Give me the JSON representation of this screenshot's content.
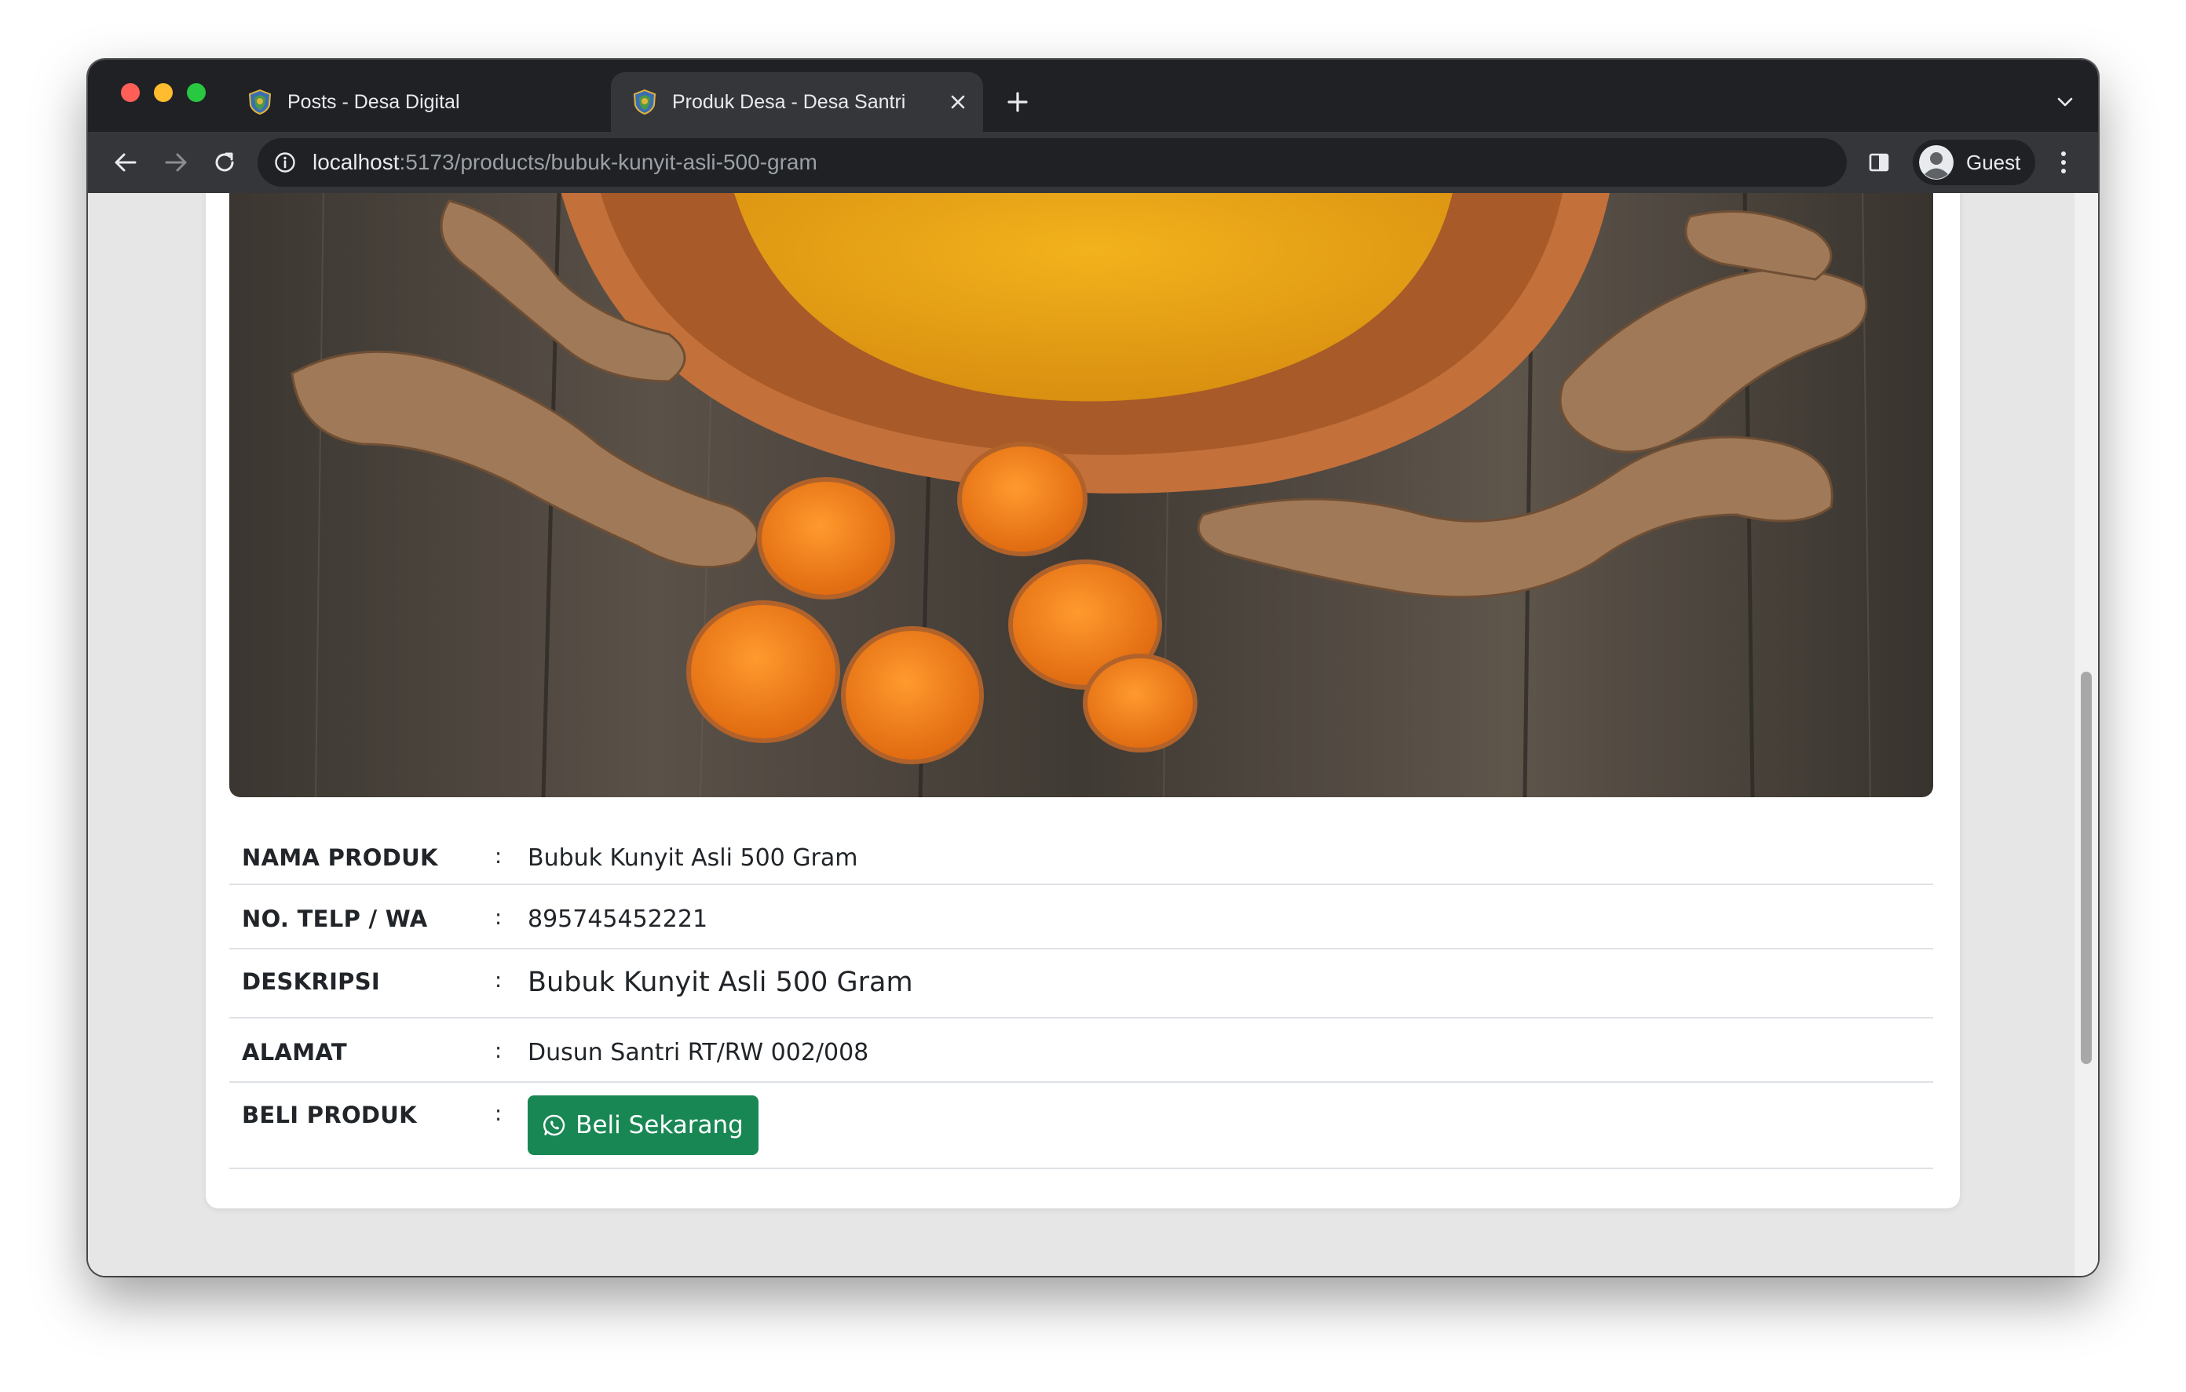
{
  "colors": {
    "window_chrome": "#202124",
    "toolbar": "#35363a",
    "page_bg": "#e6e6e6",
    "card_bg": "#ffffff",
    "buy_button": "#198754",
    "footer_gold": "#e8b820",
    "footer_green": "#2e7d32",
    "traffic_close": "#ff5f57",
    "traffic_minimize": "#febc2e",
    "traffic_zoom": "#28c840"
  },
  "browser": {
    "tabs": [
      {
        "title": "Posts - Desa Digital",
        "active": false,
        "icon": "village-emblem-icon"
      },
      {
        "title": "Produk Desa - Desa Santri",
        "active": true,
        "icon": "village-emblem-icon"
      }
    ],
    "url_host": "localhost",
    "url_path": ":5173/products/bubuk-kunyit-asli-500-gram",
    "profile_name": "Guest"
  },
  "product": {
    "image_icon": "turmeric-product-photo",
    "rows": [
      {
        "label": "NAMA PRODUK",
        "separator": ":",
        "value": "Bubuk Kunyit Asli 500 Gram"
      },
      {
        "label": "NO. TELP / WA",
        "separator": ":",
        "value": "895745452221"
      },
      {
        "label": "DESKRIPSI",
        "separator": ":",
        "value": "Bubuk Kunyit Asli 500 Gram"
      },
      {
        "label": "ALAMAT",
        "separator": ":",
        "value": "Dusun Santri RT/RW 002/008"
      },
      {
        "label": "BELI PRODUK",
        "separator": ":",
        "value": ""
      }
    ],
    "buy_button_label": "Beli Sekarang",
    "buy_button_icon": "whatsapp-icon"
  }
}
